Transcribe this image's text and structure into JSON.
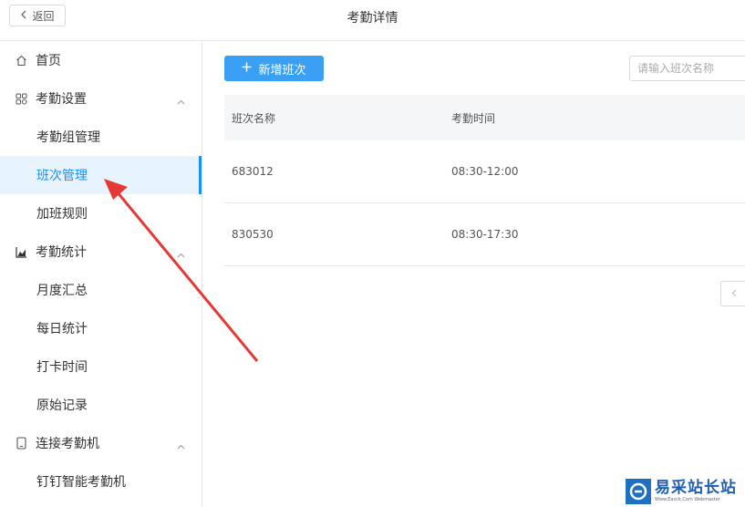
{
  "header": {
    "back_label": "返回",
    "title": "考勤详情"
  },
  "sidebar": {
    "home": "首页",
    "attendance_settings": {
      "label": "考勤设置",
      "items": [
        "考勤组管理",
        "班次管理",
        "加班规则"
      ]
    },
    "attendance_stats": {
      "label": "考勤统计",
      "items": [
        "月度汇总",
        "每日统计",
        "打卡时间",
        "原始记录"
      ]
    },
    "connect_device": {
      "label": "连接考勤机",
      "items": [
        "钉钉智能考勤机"
      ]
    },
    "active_item": "班次管理"
  },
  "toolbar": {
    "add_label": "新增班次",
    "search_placeholder": "请输入班次名称"
  },
  "table": {
    "columns": [
      "班次名称",
      "考勤时间"
    ],
    "rows": [
      [
        "683012",
        "08:30-12:00"
      ],
      [
        "830530",
        "08:30-17:30"
      ]
    ]
  },
  "watermark": {
    "title": "易采站长站",
    "subtitle": "Www.Easck.Com Webmaster"
  },
  "colors": {
    "accent": "#1890ff",
    "button": "#3aa0f3",
    "annotation_arrow": "#e53935"
  }
}
